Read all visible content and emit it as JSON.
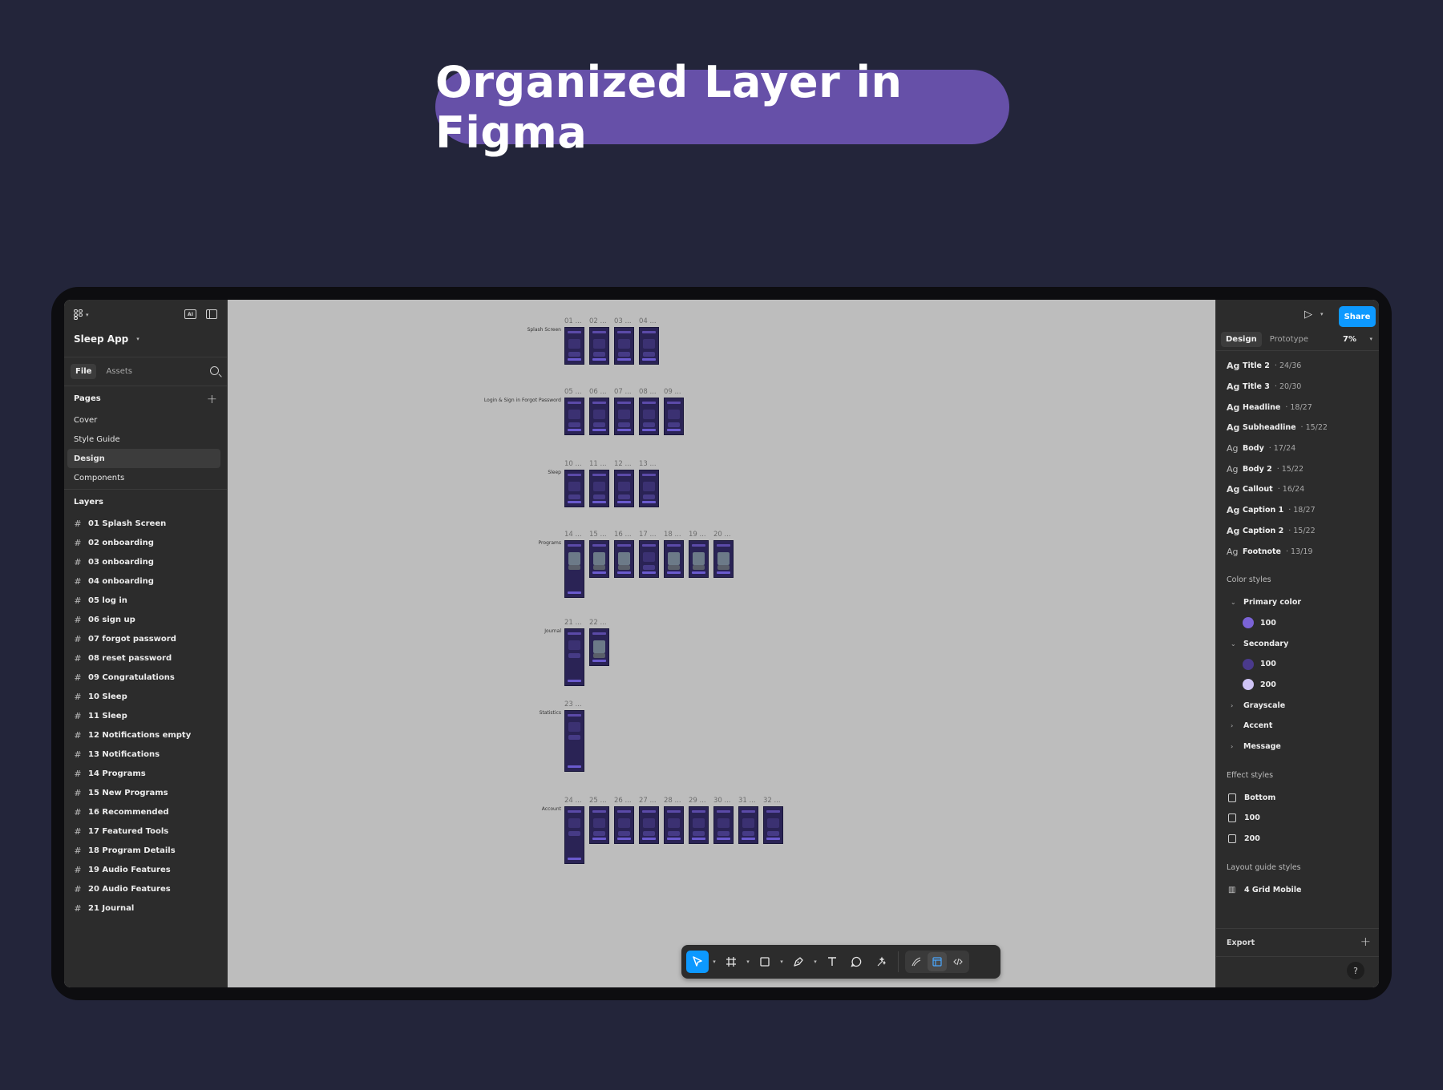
{
  "hero": {
    "title": "Organized Layer in Figma"
  },
  "left_panel": {
    "project_name": "Sleep App",
    "ai_badge": "AI",
    "tabs": [
      "File",
      "Assets"
    ],
    "pages_heading": "Pages",
    "pages": [
      "Cover",
      "Style Guide",
      "Design",
      "Components"
    ],
    "active_page": "Design",
    "layers_heading": "Layers",
    "layers": [
      "01 Splash Screen",
      "02 onboarding",
      "03 onboarding",
      "04 onboarding",
      "05 log in",
      "06 sign up",
      "07 forgot password",
      "08 reset password",
      "09 Congratulations",
      "10 Sleep",
      "11 Sleep",
      "12 Notifications empty",
      "13 Notifications",
      "14 Programs",
      "15 New Programs",
      "16 Recommended",
      "17 Featured Tools",
      "18 Program Details",
      "19 Audio Features",
      "20 Audio Features",
      "21 Journal"
    ]
  },
  "canvas": {
    "sections": [
      {
        "label": "Splash Screen",
        "frames": [
          "01 ...",
          "02 ...",
          "03 ...",
          "04 ..."
        ]
      },
      {
        "label": "Login & Sign in Forgot Password",
        "frames": [
          "05 ...",
          "06 ...",
          "07 ...",
          "08 ...",
          "09 ..."
        ]
      },
      {
        "label": "Sleep",
        "frames": [
          "10 ...",
          "11 ...",
          "12 ...",
          "13 ..."
        ]
      },
      {
        "label": "Programs",
        "frames": [
          "14 ...",
          "15 ...",
          "16 ...",
          "17 ...",
          "18 ...",
          "19 ...",
          "20 ..."
        ]
      },
      {
        "label": "Journal",
        "frames": [
          "21 ...",
          "22 ..."
        ]
      },
      {
        "label": "Statistics",
        "frames": [
          "23 ..."
        ]
      },
      {
        "label": "Account",
        "frames": [
          "24 ...",
          "25 ...",
          "26 ...",
          "27 ...",
          "28 ...",
          "29 ...",
          "30 ...",
          "31 ...",
          "32 ..."
        ]
      }
    ]
  },
  "toolbar": {
    "tools": [
      "move-tool",
      "frame-tool",
      "shape-tool",
      "pen-tool",
      "text-tool",
      "comment-tool",
      "actions-tool"
    ],
    "modes": [
      "draw-mode",
      "design-mode",
      "dev-mode"
    ]
  },
  "right_panel": {
    "share_label": "Share",
    "tabs": [
      "Design",
      "Prototype"
    ],
    "zoom": "7%",
    "text_styles": [
      {
        "name": "Title 2",
        "spec": "· 24/36"
      },
      {
        "name": "Title 3",
        "spec": "· 20/30"
      },
      {
        "name": "Headline",
        "spec": "· 18/27"
      },
      {
        "name": "Subheadline",
        "spec": "· 15/22"
      },
      {
        "name": "Body",
        "spec": "· 17/24"
      },
      {
        "name": "Body 2",
        "spec": "· 15/22"
      },
      {
        "name": "Callout",
        "spec": "· 16/24"
      },
      {
        "name": "Caption 1",
        "spec": "· 18/27"
      },
      {
        "name": "Caption 2",
        "spec": "· 15/22"
      },
      {
        "name": "Footnote",
        "spec": "· 13/19"
      }
    ],
    "ag_label": "Ag",
    "color_styles_heading": "Color styles",
    "primary_color": {
      "name": "Primary color",
      "swatches": [
        {
          "label": "100",
          "color": "#7b63d6"
        }
      ]
    },
    "secondary": {
      "name": "Secondary",
      "swatches": [
        {
          "label": "100",
          "color": "#4a3a8c"
        },
        {
          "label": "200",
          "color": "#cfc4f5"
        }
      ]
    },
    "collapsed_groups": [
      "Grayscale",
      "Accent",
      "Message"
    ],
    "effect_styles_heading": "Effect styles",
    "effect_styles": [
      "Bottom",
      "100",
      "200"
    ],
    "layout_guide_heading": "Layout guide styles",
    "layout_guides": [
      "4 Grid Mobile"
    ],
    "export_label": "Export",
    "help_label": "?"
  }
}
